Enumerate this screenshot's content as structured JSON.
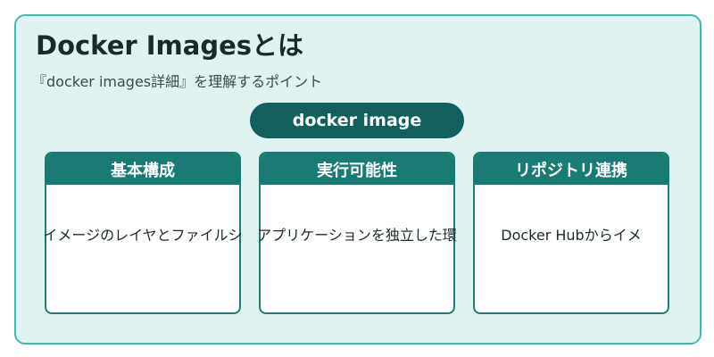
{
  "title": "Docker Imagesとは",
  "subtitle": "『docker images詳細』を理解するポイント",
  "root": "docker image",
  "cards": [
    {
      "header": "基本構成",
      "body": "イメージのレイヤとファイルシ"
    },
    {
      "header": "実行可能性",
      "body": "アプリケーションを独立した環"
    },
    {
      "header": "リポジトリ連携",
      "body": "Docker Hubからイメ"
    }
  ],
  "colors": {
    "frame_border": "#4db3ad",
    "frame_fill": "#e0f3f2",
    "root_fill": "#11605d",
    "card_header": "#1a7a76"
  }
}
